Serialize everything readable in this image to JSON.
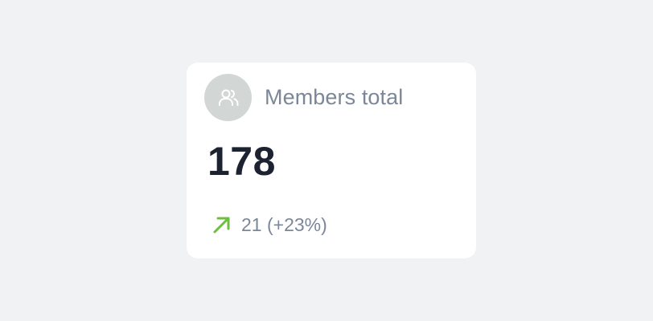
{
  "card": {
    "icon": "users-icon",
    "title": "Members total",
    "value": "178",
    "trend": {
      "icon": "arrow-up-right-icon",
      "direction": "up",
      "color": "#6cbf3f",
      "text": "21 (+23%)"
    }
  },
  "colors": {
    "background": "#f1f2f4",
    "card": "#ffffff",
    "avatar": "#d2d7d5",
    "title": "#7b8799",
    "value": "#1d2230"
  }
}
